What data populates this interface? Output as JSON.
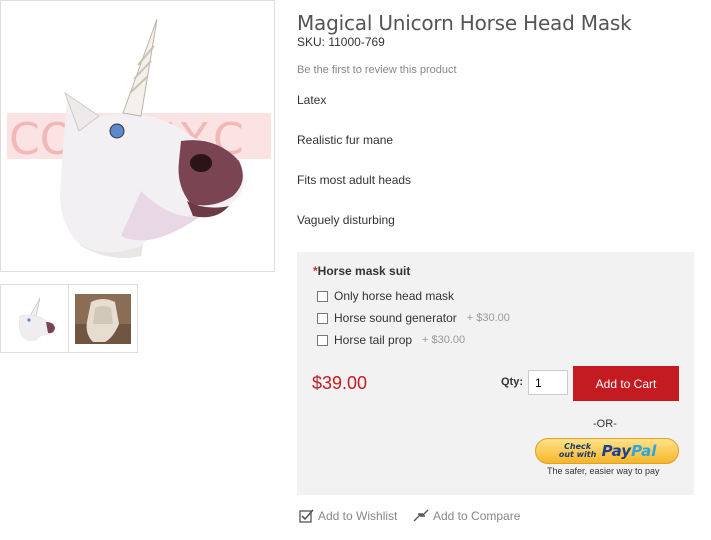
{
  "product": {
    "title": "Magical Unicorn Horse Head Mask",
    "sku": "SKU: 11000-769",
    "review_link": "Be the first to review this product",
    "features": [
      "Latex",
      "Realistic fur mane",
      "Fits most adult heads",
      "Vaguely disturbing"
    ],
    "price": "$39.00"
  },
  "gallery": {
    "watermark": "COSPLAY.C"
  },
  "options": {
    "required_mark": "*",
    "label": "Horse mask suit",
    "items": [
      {
        "label": "Only horse head mask",
        "price": ""
      },
      {
        "label": "Horse sound generator",
        "price": "+ $30.00"
      },
      {
        "label": "Horse tail prop",
        "price": "+ $30.00"
      }
    ]
  },
  "cart": {
    "qty_label": "Qty:",
    "qty_value": "1",
    "add_to_cart": "Add to Cart",
    "or": "-OR-",
    "paypal_checkout": "Check out with",
    "paypal_brand_1": "Pay",
    "paypal_brand_2": "Pal",
    "paypal_tagline": "The safer, easier way to pay"
  },
  "links": {
    "wishlist": "Add to Wishlist",
    "compare": "Add to Compare"
  },
  "colors": {
    "accent": "#c31b21",
    "panel": "#f2f2f2"
  }
}
